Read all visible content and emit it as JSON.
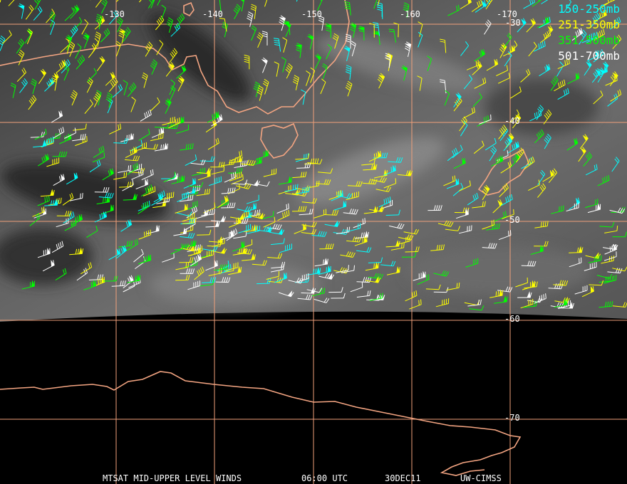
{
  "footer": {
    "product": "MTSAT MID-UPPER LEVEL WINDS",
    "time": "06:00 UTC",
    "date": "30DEC11",
    "credit": "UW-CIMSS"
  },
  "legend": [
    {
      "label": "150-250mb",
      "color": "#00ffff"
    },
    {
      "label": "251-350mb",
      "color": "#ffff00"
    },
    {
      "label": "351-500mb",
      "color": "#00ff00"
    },
    {
      "label": "501-700mb",
      "color": "#ffffff"
    }
  ],
  "grid": {
    "longitude_labels": [
      "-130",
      "-140",
      "-150",
      "-160",
      "-170"
    ],
    "latitude_labels": [
      "-30",
      "-40",
      "-50",
      "-60",
      "-70"
    ],
    "grid_color": "#f0a07a",
    "coast_color": "#f4a582"
  },
  "icons": [
    "wind-barb-icon",
    "coastline-outline"
  ]
}
